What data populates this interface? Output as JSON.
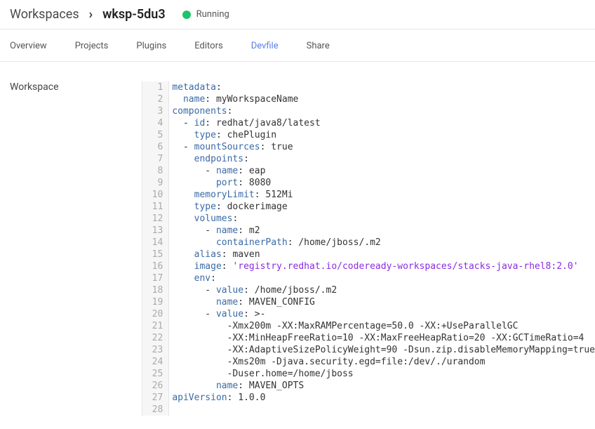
{
  "header": {
    "breadcrumb_root": "Workspaces",
    "workspace_name": "wksp-5du3",
    "status_text": "Running",
    "status_color": "#1ec36a"
  },
  "tabs": [
    {
      "id": "overview",
      "label": "Overview",
      "active": false
    },
    {
      "id": "projects",
      "label": "Projects",
      "active": false
    },
    {
      "id": "plugins",
      "label": "Plugins",
      "active": false
    },
    {
      "id": "editors",
      "label": "Editors",
      "active": false
    },
    {
      "id": "devfile",
      "label": "Devfile",
      "active": true
    },
    {
      "id": "share",
      "label": "Share",
      "active": false
    }
  ],
  "sidebar": {
    "section_label": "Workspace"
  },
  "devfile": {
    "metadata": {
      "name": "myWorkspaceName"
    },
    "components": [
      {
        "id": "redhat/java8/latest",
        "type": "chePlugin"
      },
      {
        "mountSources": true,
        "endpoints": [
          {
            "name": "eap",
            "port": 8080
          }
        ],
        "memoryLimit": "512Mi",
        "type": "dockerimage",
        "volumes": [
          {
            "name": "m2",
            "containerPath": "/home/jboss/.m2"
          }
        ],
        "alias": "maven",
        "image": "registry.redhat.io/codeready-workspaces/stacks-java-rhel8:2.0",
        "env": [
          {
            "value": "/home/jboss/.m2",
            "name": "MAVEN_CONFIG"
          },
          {
            "value": "-Xmx200m -XX:MaxRAMPercentage=50.0 -XX:+UseParallelGC -XX:MinHeapFreeRatio=10 -XX:MaxFreeHeapRatio=20 -XX:GCTimeRatio=4 -XX:AdaptiveSizePolicyWeight=90 -Dsun.zip.disableMemoryMapping=true -Xms20m -Djava.security.egd=file:/dev/./urandom -Duser.home=/home/jboss",
            "name": "MAVEN_OPTS"
          }
        ]
      }
    ],
    "apiVersion": "1.0.0"
  },
  "editor_lines": [
    [
      [
        "k",
        "metadata"
      ],
      [
        "c",
        ":"
      ]
    ],
    [
      [
        "c",
        "  "
      ],
      [
        "k",
        "name"
      ],
      [
        "c",
        ": "
      ],
      [
        "s",
        "myWorkspaceName"
      ]
    ],
    [
      [
        "k",
        "components"
      ],
      [
        "c",
        ":"
      ]
    ],
    [
      [
        "c",
        "  "
      ],
      [
        "d",
        "- "
      ],
      [
        "k",
        "id"
      ],
      [
        "c",
        ": "
      ],
      [
        "s",
        "redhat/java8/latest"
      ]
    ],
    [
      [
        "c",
        "    "
      ],
      [
        "k",
        "type"
      ],
      [
        "c",
        ": "
      ],
      [
        "s",
        "chePlugin"
      ]
    ],
    [
      [
        "c",
        "  "
      ],
      [
        "d",
        "- "
      ],
      [
        "k",
        "mountSources"
      ],
      [
        "c",
        ": "
      ],
      [
        "s",
        "true"
      ]
    ],
    [
      [
        "c",
        "    "
      ],
      [
        "k",
        "endpoints"
      ],
      [
        "c",
        ":"
      ]
    ],
    [
      [
        "c",
        "      "
      ],
      [
        "d",
        "- "
      ],
      [
        "k",
        "name"
      ],
      [
        "c",
        ": "
      ],
      [
        "s",
        "eap"
      ]
    ],
    [
      [
        "c",
        "        "
      ],
      [
        "k",
        "port"
      ],
      [
        "c",
        ": "
      ],
      [
        "s",
        "8080"
      ]
    ],
    [
      [
        "c",
        "    "
      ],
      [
        "k",
        "memoryLimit"
      ],
      [
        "c",
        ": "
      ],
      [
        "s",
        "512Mi"
      ]
    ],
    [
      [
        "c",
        "    "
      ],
      [
        "k",
        "type"
      ],
      [
        "c",
        ": "
      ],
      [
        "s",
        "dockerimage"
      ]
    ],
    [
      [
        "c",
        "    "
      ],
      [
        "k",
        "volumes"
      ],
      [
        "c",
        ":"
      ]
    ],
    [
      [
        "c",
        "      "
      ],
      [
        "d",
        "- "
      ],
      [
        "k",
        "name"
      ],
      [
        "c",
        ": "
      ],
      [
        "s",
        "m2"
      ]
    ],
    [
      [
        "c",
        "        "
      ],
      [
        "k",
        "containerPath"
      ],
      [
        "c",
        ": "
      ],
      [
        "s",
        "/home/jboss/.m2"
      ]
    ],
    [
      [
        "c",
        "    "
      ],
      [
        "k",
        "alias"
      ],
      [
        "c",
        ": "
      ],
      [
        "s",
        "maven"
      ]
    ],
    [
      [
        "c",
        "    "
      ],
      [
        "k",
        "image"
      ],
      [
        "c",
        ": "
      ],
      [
        "q",
        "'registry.redhat.io/codeready-workspaces/stacks-java-rhel8:2.0'"
      ]
    ],
    [
      [
        "c",
        "    "
      ],
      [
        "k",
        "env"
      ],
      [
        "c",
        ":"
      ]
    ],
    [
      [
        "c",
        "      "
      ],
      [
        "d",
        "- "
      ],
      [
        "k",
        "value"
      ],
      [
        "c",
        ": "
      ],
      [
        "s",
        "/home/jboss/.m2"
      ]
    ],
    [
      [
        "c",
        "        "
      ],
      [
        "k",
        "name"
      ],
      [
        "c",
        ": "
      ],
      [
        "s",
        "MAVEN_CONFIG"
      ]
    ],
    [
      [
        "c",
        "      "
      ],
      [
        "d",
        "- "
      ],
      [
        "k",
        "value"
      ],
      [
        "c",
        ": "
      ],
      [
        "s",
        ">-"
      ]
    ],
    [
      [
        "c",
        "          "
      ],
      [
        "s",
        "-Xmx200m -XX:MaxRAMPercentage=50.0 -XX:+UseParallelGC"
      ]
    ],
    [
      [
        "c",
        "          "
      ],
      [
        "s",
        "-XX:MinHeapFreeRatio=10 -XX:MaxFreeHeapRatio=20 -XX:GCTimeRatio=4"
      ]
    ],
    [
      [
        "c",
        "          "
      ],
      [
        "s",
        "-XX:AdaptiveSizePolicyWeight=90 -Dsun.zip.disableMemoryMapping=true"
      ]
    ],
    [
      [
        "c",
        "          "
      ],
      [
        "s",
        "-Xms20m -Djava.security.egd=file:/dev/./urandom"
      ]
    ],
    [
      [
        "c",
        "          "
      ],
      [
        "s",
        "-Duser.home=/home/jboss"
      ]
    ],
    [
      [
        "c",
        "        "
      ],
      [
        "k",
        "name"
      ],
      [
        "c",
        ": "
      ],
      [
        "s",
        "MAVEN_OPTS"
      ]
    ],
    [
      [
        "k",
        "apiVersion"
      ],
      [
        "c",
        ": "
      ],
      [
        "s",
        "1.0.0"
      ]
    ],
    []
  ]
}
